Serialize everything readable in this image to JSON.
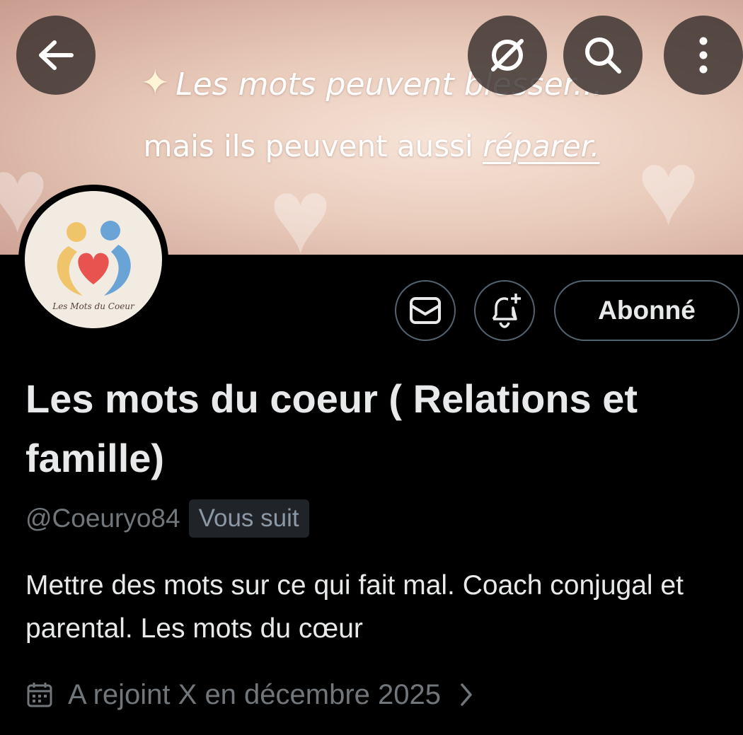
{
  "banner": {
    "line1": "Les mots peuvent blesser...",
    "line2_plain": "mais ils peuvent aussi ",
    "line2_emphasis": "réparer."
  },
  "top_actions": {
    "back_icon": "arrow-left-icon",
    "grok_icon": "grok-icon",
    "search_icon": "search-icon",
    "more_icon": "more-vertical-icon"
  },
  "avatar": {
    "caption": "Les Mots du Coeur",
    "colors": {
      "left_figure": "#f0c46a",
      "right_figure": "#6aa3d6",
      "heart": "#e8534f"
    }
  },
  "actions": {
    "message_icon": "mail-icon",
    "notify_icon": "bell-plus-icon",
    "follow_label": "Abonné"
  },
  "profile": {
    "display_name": "Les mots du coeur ( Relations et famille)",
    "handle": "@Coeuryo84",
    "follows_you": "Vous suit",
    "bio": "Mettre des mots sur ce qui fait mal. Coach conjugal et parental. Les mots du cœur",
    "joined": "A rejoint X en décembre 2025",
    "joined_icon": "calendar-icon"
  },
  "colors": {
    "background": "#000000",
    "text_primary": "#e7e9ea",
    "text_secondary": "#71767b",
    "border": "#536471"
  }
}
